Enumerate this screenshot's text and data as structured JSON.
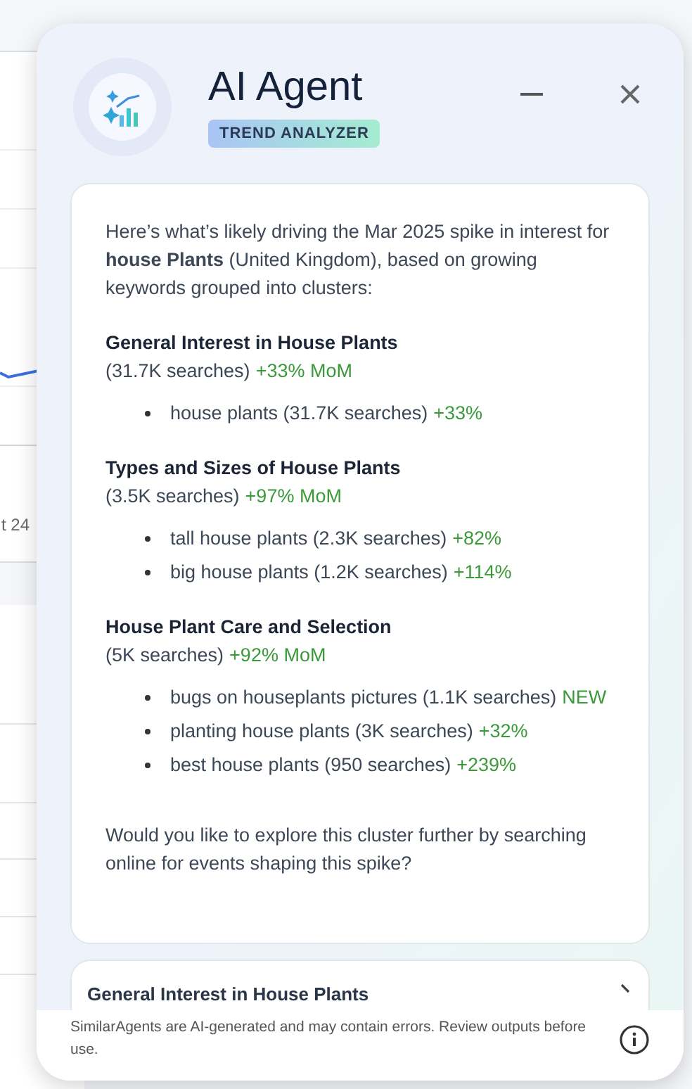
{
  "background": {
    "axis_label": "t 24"
  },
  "panel": {
    "title": "AI Agent",
    "badge": "TREND ANALYZER",
    "intro": "Here’s what’s likely driving the Mar 2025 spike in interest for **house Plants** (United Kingdom), based on growing keywords grouped into clusters:",
    "clusters": [
      {
        "title": "General Interest in House Plants",
        "searches": "(31.7K searches)",
        "growth": "+33% MoM",
        "keywords": [
          {
            "text": "house plants (31.7K searches)",
            "growth": "+33%"
          }
        ]
      },
      {
        "title": "Types and Sizes of House Plants",
        "searches": "(3.5K searches)",
        "growth": "+97% MoM",
        "keywords": [
          {
            "text": "tall house plants (2.3K searches)",
            "growth": "+82%"
          },
          {
            "text": "big house plants (1.2K searches)",
            "growth": "+114%"
          }
        ]
      },
      {
        "title": "House Plant Care and Selection",
        "searches": "(5K searches)",
        "growth": "+92% MoM",
        "keywords": [
          {
            "text": "bugs on houseplants pictures (1.1K searches)",
            "growth": "NEW"
          },
          {
            "text": "planting house plants (3K searches)",
            "growth": "+32%"
          },
          {
            "text": "best house plants (950 searches)",
            "growth": "+239%"
          }
        ]
      }
    ],
    "question": "Would you like to explore this cluster further by searching online for events shaping this spike?",
    "next_card": {
      "title": "General Interest in House Plants"
    },
    "footer": "SimilarAgents are AI-generated and may contain errors. Review outputs before use."
  }
}
